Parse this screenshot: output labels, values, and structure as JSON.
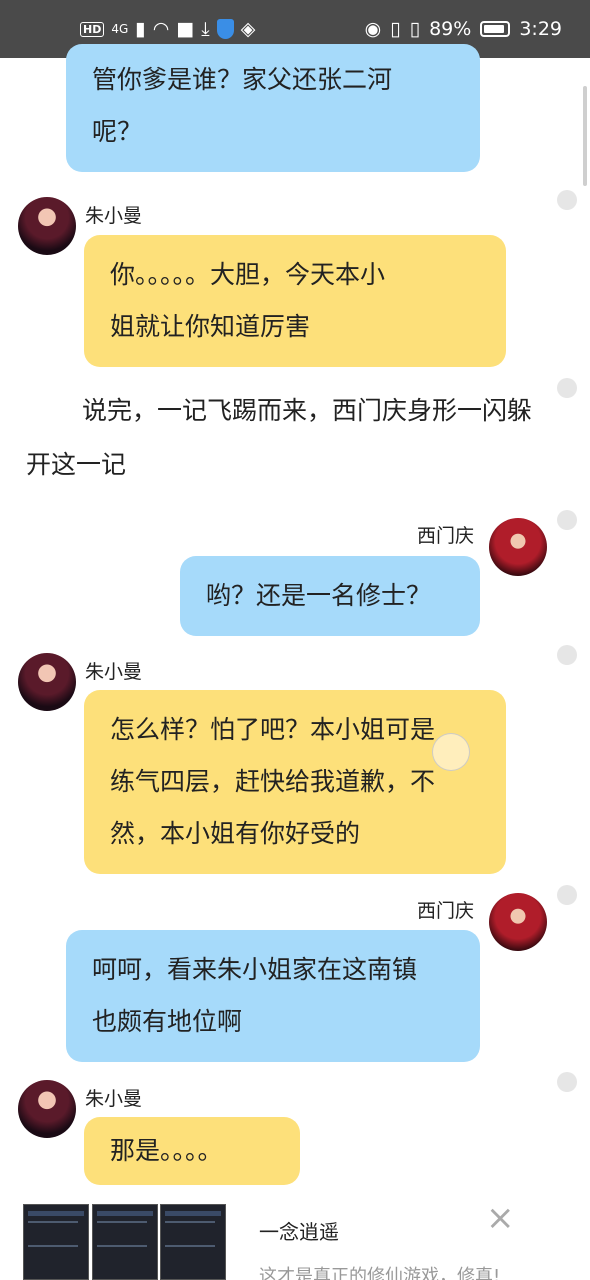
{
  "status_bar": {
    "hd": "HD",
    "net": "4G",
    "battery": "89%",
    "time": "3:29"
  },
  "chat": {
    "msg1_text": "管你爹是谁？家父还张二河\n呢？",
    "msg2": {
      "name": "朱小曼",
      "text": "你。。。。。大胆，今天本小\n姐就让你知道厉害"
    },
    "narration1": "说完，一记飞踢而来，西门庆身形一闪躲开这一记",
    "msg3": {
      "name": "西门庆",
      "text": "哟？还是一名修士？"
    },
    "msg4": {
      "name": "朱小曼",
      "text": "怎么样？怕了吧？本小姐可是\n练气四层，赶快给我道歉，不\n然，本小姐有你好受的"
    },
    "msg5": {
      "name": "西门庆",
      "text": "呵呵，看来朱小姐家在这南镇\n也颇有地位啊"
    },
    "msg6": {
      "name": "朱小曼",
      "text": "那是。。。。"
    }
  },
  "ad": {
    "title": "一念逍遥",
    "subtitle": "这才是真正的修仙游戏，修真!"
  },
  "icons": {
    "close": "×"
  },
  "colors": {
    "blue_bubble": "#a6dafa",
    "yellow_bubble": "#fde07a",
    "status_bar": "#4a4a4a"
  }
}
